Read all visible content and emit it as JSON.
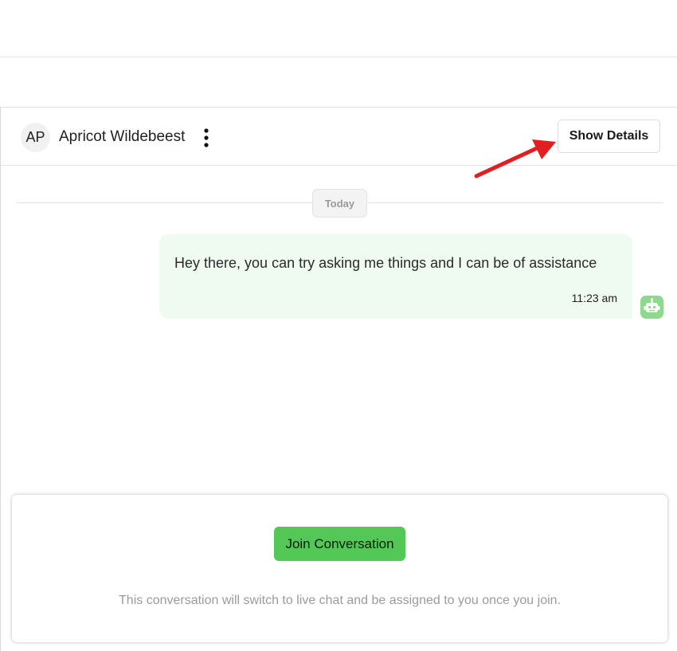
{
  "chat": {
    "avatar_initials": "AP",
    "contact_name": "Apricot Wildebeest",
    "menu_icon": "more-vertical-icon",
    "show_details_label": "Show Details"
  },
  "messages": {
    "date_separator": "Today",
    "items": [
      {
        "text": "Hey there, you can try asking me things and I can be of assistance",
        "time": "11:23 am",
        "sender_icon": "bot-icon"
      }
    ]
  },
  "join": {
    "button_label": "Join Conversation",
    "note": "This conversation will switch to live chat and be assigned to you once you join."
  },
  "colors": {
    "accent_green": "#54c857",
    "bubble_bg": "#effaf0",
    "arrow_red": "#e02020",
    "bot_icon_bg": "#8fd98f"
  }
}
